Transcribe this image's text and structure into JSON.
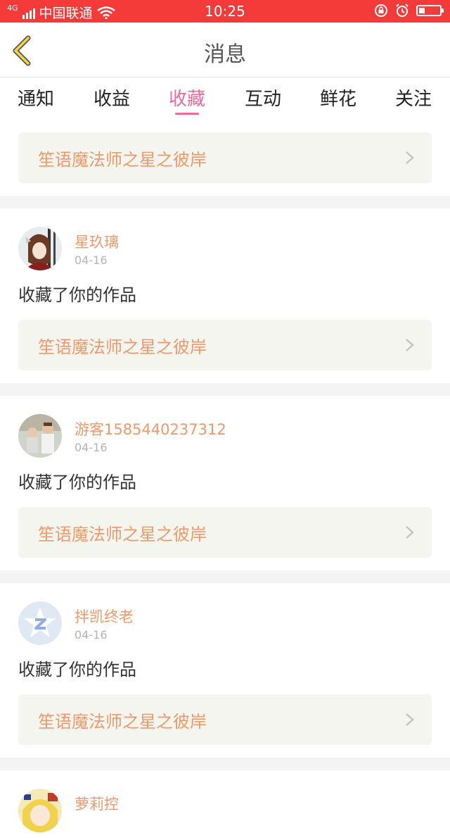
{
  "status_bar": {
    "network": "4G",
    "carrier": "中国联通",
    "time": "10:25"
  },
  "header": {
    "title": "消息",
    "back_icon": "chevron-left-icon"
  },
  "tabs": [
    {
      "label": "通知",
      "active": false
    },
    {
      "label": "收益",
      "active": false
    },
    {
      "label": "收藏",
      "active": true
    },
    {
      "label": "互动",
      "active": false
    },
    {
      "label": "鲜花",
      "active": false
    },
    {
      "label": "关注",
      "active": false
    }
  ],
  "top_work": {
    "title": "笙语魔法师之星之彼岸"
  },
  "items": [
    {
      "user": "星玖璃",
      "date": "04-16",
      "action": "收藏了你的作品",
      "work": "笙语魔法师之星之彼岸",
      "avatar": "anime-girl-avatar"
    },
    {
      "user": "游客1585440237312",
      "date": "04-16",
      "action": "收藏了你的作品",
      "work": "笙语魔法师之星之彼岸",
      "avatar": "kids-photo-avatar"
    },
    {
      "user": "拌凯终老",
      "date": "04-16",
      "action": "收藏了你的作品",
      "work": "笙语魔法师之星之彼岸",
      "avatar": "qq-default-avatar"
    },
    {
      "user": "萝莉控",
      "date": "",
      "action": "",
      "work": "",
      "avatar": "anime-avatar"
    }
  ],
  "colors": {
    "status_bar": "#f53a3a",
    "accent_tab": "#ef6a9a",
    "username": "#f0996a",
    "work_title": "#f0996a",
    "card_bg": "#f5f5f0"
  }
}
